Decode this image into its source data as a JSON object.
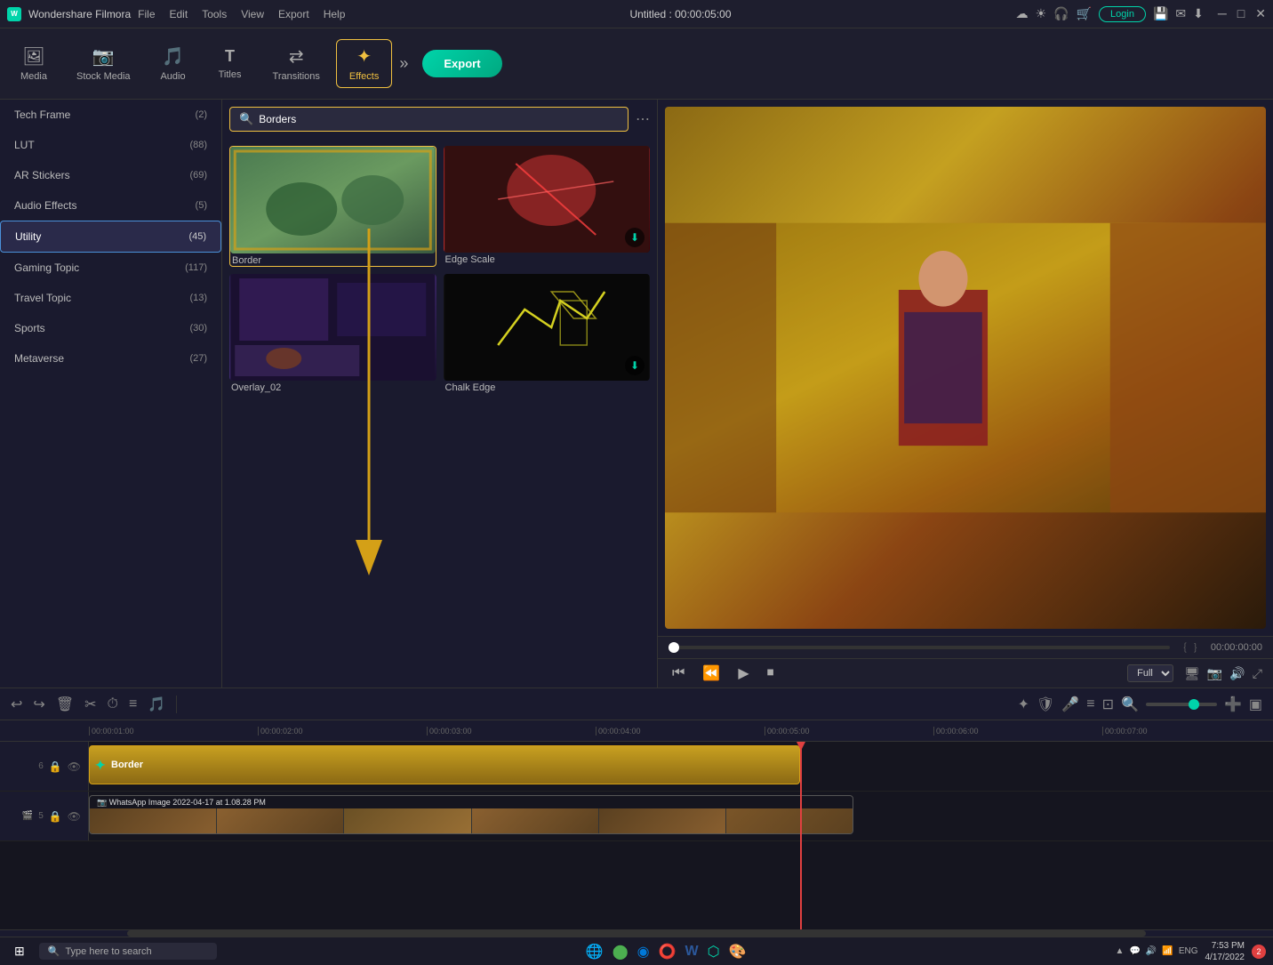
{
  "app": {
    "name": "Wondershare Filmora",
    "logo": "W",
    "title": "Untitled : 00:00:05:00",
    "date": "4/17/2022",
    "time": "7:53 PM"
  },
  "menu": {
    "items": [
      "File",
      "Edit",
      "Tools",
      "View",
      "Export",
      "Help"
    ]
  },
  "titlebar_icons": [
    "☁",
    "☀",
    "🎧",
    "🛒"
  ],
  "login_label": "Login",
  "toolbar": {
    "items": [
      {
        "id": "media",
        "icon": "🖼",
        "label": "Media"
      },
      {
        "id": "stock",
        "icon": "📷",
        "label": "Stock Media"
      },
      {
        "id": "audio",
        "icon": "🎵",
        "label": "Audio"
      },
      {
        "id": "titles",
        "icon": "T",
        "label": "Titles"
      },
      {
        "id": "transitions",
        "icon": "⟷",
        "label": "Transitions"
      },
      {
        "id": "effects",
        "icon": "✦",
        "label": "Effects"
      }
    ],
    "export_label": "Export"
  },
  "left_panel": {
    "items": [
      {
        "label": "Tech Frame",
        "count": 2
      },
      {
        "label": "LUT",
        "count": 88
      },
      {
        "label": "AR Stickers",
        "count": 69
      },
      {
        "label": "Audio Effects",
        "count": 5
      },
      {
        "label": "Utility",
        "count": 45,
        "active": true
      },
      {
        "label": "Gaming Topic",
        "count": 117
      },
      {
        "label": "Travel Topic",
        "count": 13
      },
      {
        "label": "Sports",
        "count": 30
      },
      {
        "label": "Metaverse",
        "count": 27
      }
    ]
  },
  "effects_panel": {
    "search_placeholder": "Borders",
    "effects": [
      {
        "id": "border",
        "label": "Border",
        "style": "border",
        "selected": true
      },
      {
        "id": "edge_scale",
        "label": "Edge Scale",
        "style": "edge",
        "download": true
      },
      {
        "id": "overlay_02",
        "label": "Overlay_02",
        "style": "overlay"
      },
      {
        "id": "chalk_edge",
        "label": "Chalk Edge",
        "style": "chalk",
        "download": true
      }
    ]
  },
  "preview": {
    "time_current": "00:00:00:00",
    "scrubber_percent": 0,
    "quality": "Full",
    "controls": [
      "⏮",
      "⏪",
      "▶",
      "⏹"
    ]
  },
  "timeline": {
    "toolbar_icons": [
      "↩",
      "↪",
      "🗑",
      "✂",
      "⏱",
      "≡",
      "🎵"
    ],
    "zoom_icons": [
      "🔍-",
      "🔍+"
    ],
    "rulers": [
      "00:00:01:00",
      "00:00:02:00",
      "00:00:03:00",
      "00:00:04:00",
      "00:00:05:00",
      "00:00:06:00",
      "00:00:07:00"
    ],
    "tracks": [
      {
        "num": "6",
        "type": "effect",
        "label": "Border",
        "icon": "✦"
      },
      {
        "num": "5",
        "type": "video",
        "label": "WhatsApp Image 2022-04-17 at 1.08.28 PM"
      }
    ],
    "playhead_time": "00:00:05:00"
  },
  "taskbar": {
    "start_icon": "⊞",
    "search_placeholder": "Type here to search",
    "app_icons": [
      "🌐",
      "🔵",
      "🟠",
      "🔴",
      "W",
      "⬡",
      "🎨"
    ],
    "sys_icons": [
      "▲",
      "💬",
      "🔊",
      "📶",
      "ENG"
    ],
    "time": "7:53 PM",
    "date": "4/17/2022",
    "notification": "2"
  }
}
